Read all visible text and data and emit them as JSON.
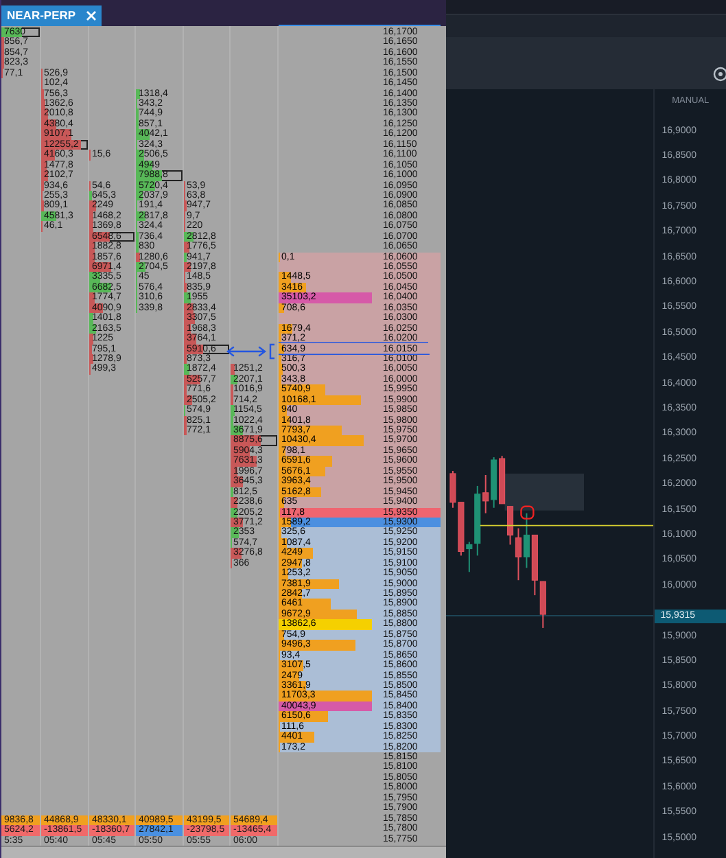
{
  "tab": {
    "label": "NEAR-PERP"
  },
  "footprint": {
    "columns": [
      {
        "cells": [
          {
            "value": "7630",
            "color": "#58b858",
            "boxed": true
          },
          {
            "value": "856,7",
            "color": "#c85858",
            "boxed": false
          },
          {
            "value": "854,7",
            "color": "#c85858",
            "boxed": false
          },
          {
            "value": "823,3",
            "color": "#c85858",
            "boxed": false
          },
          {
            "value": "77,1",
            "color": "#c85858",
            "boxed": false
          }
        ],
        "volume": "9836,8",
        "delta": {
          "value": "5624,2",
          "color": "#f06a6a"
        },
        "time": "5:35"
      },
      {
        "cells": [
          null,
          null,
          null,
          null,
          {
            "value": "526,9",
            "color": "#c85858",
            "boxed": false
          },
          {
            "value": "102,4",
            "color": "#c85858",
            "boxed": false
          },
          {
            "value": "756,3",
            "color": "#c85858",
            "boxed": false
          },
          {
            "value": "1362,6",
            "color": "#c85858",
            "boxed": false
          },
          {
            "value": "2010,8",
            "color": "#c85858",
            "boxed": false
          },
          {
            "value": "4380,4",
            "color": "#c85858",
            "boxed": false
          },
          {
            "value": "9107,1",
            "color": "#c85858",
            "boxed": false
          },
          {
            "value": "12255,2",
            "color": "#c85858",
            "boxed": true
          },
          {
            "value": "4160,3",
            "color": "#c85858",
            "boxed": false
          },
          {
            "value": "1477,8",
            "color": "#c85858",
            "boxed": false
          },
          {
            "value": "2102,7",
            "color": "#c85858",
            "boxed": false
          },
          {
            "value": "934,6",
            "color": "#c85858",
            "boxed": false
          },
          {
            "value": "255,3",
            "color": "#c85858",
            "boxed": false
          },
          {
            "value": "809,1",
            "color": "#c85858",
            "boxed": false
          },
          {
            "value": "4581,3",
            "color": "#58b858",
            "boxed": false
          },
          {
            "value": "46,1",
            "color": "#c85858",
            "boxed": false
          }
        ],
        "volume": "44868,9",
        "delta": {
          "value": "-13861,5",
          "color": "#f06a6a"
        },
        "time": "05:40"
      },
      {
        "cells": [
          null,
          null,
          null,
          null,
          null,
          null,
          null,
          null,
          null,
          null,
          null,
          null,
          {
            "value": "15,6",
            "color": "#c85858",
            "boxed": false
          },
          null,
          null,
          {
            "value": "54,6",
            "color": "#c85858",
            "boxed": false
          },
          {
            "value": "645,3",
            "color": "#58b858",
            "boxed": false
          },
          {
            "value": "2249",
            "color": "#c85858",
            "boxed": false
          },
          {
            "value": "1468,2",
            "color": "#c85858",
            "boxed": false
          },
          {
            "value": "1369,8",
            "color": "#c85858",
            "boxed": false
          },
          {
            "value": "6548,6",
            "color": "#c85858",
            "boxed": true
          },
          {
            "value": "1882,8",
            "color": "#c85858",
            "boxed": false
          },
          {
            "value": "1857,6",
            "color": "#c85858",
            "boxed": false
          },
          {
            "value": "6971,4",
            "color": "#c85858",
            "boxed": false
          },
          {
            "value": "3335,5",
            "color": "#58b858",
            "boxed": false
          },
          {
            "value": "6682,5",
            "color": "#58b858",
            "boxed": false
          },
          {
            "value": "1774,7",
            "color": "#c85858",
            "boxed": false
          },
          {
            "value": "4090,9",
            "color": "#c85858",
            "boxed": false
          },
          {
            "value": "1401,8",
            "color": "#58b858",
            "boxed": false
          },
          {
            "value": "2163,5",
            "color": "#58b858",
            "boxed": false
          },
          {
            "value": "1225",
            "color": "#c85858",
            "boxed": false
          },
          {
            "value": "795,1",
            "color": "#c85858",
            "boxed": false
          },
          {
            "value": "1278,9",
            "color": "#c85858",
            "boxed": false
          },
          {
            "value": "499,3",
            "color": "#c85858",
            "boxed": false
          }
        ],
        "volume": "48330,1",
        "delta": {
          "value": "-18360,7",
          "color": "#f06a6a"
        },
        "time": "05:45"
      },
      {
        "cells": [
          null,
          null,
          null,
          null,
          null,
          null,
          {
            "value": "1318,4",
            "color": "#58b858",
            "boxed": false
          },
          {
            "value": "343,2",
            "color": "#58b858",
            "boxed": false
          },
          {
            "value": "744,9",
            "color": "#58b858",
            "boxed": false
          },
          {
            "value": "857,1",
            "color": "#58b858",
            "boxed": false
          },
          {
            "value": "4042,1",
            "color": "#58b858",
            "boxed": false
          },
          {
            "value": "324,3",
            "color": "#58b858",
            "boxed": false
          },
          {
            "value": "2506,5",
            "color": "#58b858",
            "boxed": false
          },
          {
            "value": "4949",
            "color": "#58b858",
            "boxed": false
          },
          {
            "value": "7988,8",
            "color": "#58b858",
            "boxed": true
          },
          {
            "value": "5720,4",
            "color": "#58b858",
            "boxed": false
          },
          {
            "value": "2037,9",
            "color": "#58b858",
            "boxed": false
          },
          {
            "value": "191,4",
            "color": "#58b858",
            "boxed": false
          },
          {
            "value": "2817,8",
            "color": "#58b858",
            "boxed": false
          },
          {
            "value": "324,4",
            "color": "#58b858",
            "boxed": false
          },
          {
            "value": "736,4",
            "color": "#58b858",
            "boxed": false
          },
          {
            "value": "830",
            "color": "#58b858",
            "boxed": false
          },
          {
            "value": "1280,6",
            "color": "#c85858",
            "boxed": false
          },
          {
            "value": "2704,5",
            "color": "#58b858",
            "boxed": false
          },
          {
            "value": "45",
            "color": "#58b858",
            "boxed": false
          },
          {
            "value": "576,4",
            "color": "#58b858",
            "boxed": false
          },
          {
            "value": "310,6",
            "color": "#58b858",
            "boxed": false
          },
          {
            "value": "339,8",
            "color": "#58b858",
            "boxed": false
          }
        ],
        "volume": "40989,5",
        "delta": {
          "value": "27842,1",
          "color": "#4a90e0"
        },
        "time": "05:50"
      },
      {
        "cells": [
          null,
          null,
          null,
          null,
          null,
          null,
          null,
          null,
          null,
          null,
          null,
          null,
          null,
          null,
          null,
          {
            "value": "53,9",
            "color": "#c85858",
            "boxed": false
          },
          {
            "value": "63,8",
            "color": "#c85858",
            "boxed": false
          },
          {
            "value": "947,7",
            "color": "#c85858",
            "boxed": false
          },
          {
            "value": "9,7",
            "color": "#c85858",
            "boxed": false
          },
          {
            "value": "220",
            "color": "#c85858",
            "boxed": false
          },
          {
            "value": "2812,8",
            "color": "#58b858",
            "boxed": false
          },
          {
            "value": "1776,5",
            "color": "#c85858",
            "boxed": false
          },
          {
            "value": "941,7",
            "color": "#58b858",
            "boxed": false
          },
          {
            "value": "2197,8",
            "color": "#c85858",
            "boxed": false
          },
          {
            "value": "148,5",
            "color": "#c85858",
            "boxed": false
          },
          {
            "value": "835,9",
            "color": "#c85858",
            "boxed": false
          },
          {
            "value": "1955",
            "color": "#58b858",
            "boxed": false
          },
          {
            "value": "2833,4",
            "color": "#c85858",
            "boxed": false
          },
          {
            "value": "3307,5",
            "color": "#c85858",
            "boxed": false
          },
          {
            "value": "1968,3",
            "color": "#c85858",
            "boxed": false
          },
          {
            "value": "3764,1",
            "color": "#c85858",
            "boxed": false
          },
          {
            "value": "5910,6",
            "color": "#c85858",
            "boxed": true
          },
          {
            "value": "873,3",
            "color": "#c85858",
            "boxed": false
          },
          {
            "value": "1872,4",
            "color": "#58b858",
            "boxed": false
          },
          {
            "value": "5257,7",
            "color": "#c85858",
            "boxed": false
          },
          {
            "value": "771,6",
            "color": "#c85858",
            "boxed": false
          },
          {
            "value": "2505,2",
            "color": "#c85858",
            "boxed": false
          },
          {
            "value": "574,9",
            "color": "#58b858",
            "boxed": false
          },
          {
            "value": "825,1",
            "color": "#c85858",
            "boxed": false
          },
          {
            "value": "772,1",
            "color": "#c85858",
            "boxed": false
          }
        ],
        "volume": "43199,5",
        "delta": {
          "value": "-23798,5",
          "color": "#f06a6a"
        },
        "time": "05:55"
      },
      {
        "cells": [
          null,
          null,
          null,
          null,
          null,
          null,
          null,
          null,
          null,
          null,
          null,
          null,
          null,
          null,
          null,
          null,
          null,
          null,
          null,
          null,
          null,
          null,
          null,
          null,
          null,
          null,
          null,
          null,
          null,
          null,
          null,
          null,
          null,
          {
            "value": "1251,2",
            "color": "#c85858",
            "boxed": false
          },
          {
            "value": "2207,1",
            "color": "#58b858",
            "boxed": false
          },
          {
            "value": "1016,9",
            "color": "#c85858",
            "boxed": false
          },
          {
            "value": "714,2",
            "color": "#c85858",
            "boxed": false
          },
          {
            "value": "1154,5",
            "color": "#58b858",
            "boxed": false
          },
          {
            "value": "1022,4",
            "color": "#58b858",
            "boxed": false
          },
          {
            "value": "3671,9",
            "color": "#58b858",
            "boxed": false
          },
          {
            "value": "8875,6",
            "color": "#c85858",
            "boxed": true
          },
          {
            "value": "5904,3",
            "color": "#c85858",
            "boxed": false
          },
          {
            "value": "7631,3",
            "color": "#c85858",
            "boxed": false
          },
          {
            "value": "1996,7",
            "color": "#c85858",
            "boxed": false
          },
          {
            "value": "3645,3",
            "color": "#c85858",
            "boxed": false
          },
          {
            "value": "812,5",
            "color": "#58b858",
            "boxed": false
          },
          {
            "value": "2238,6",
            "color": "#c85858",
            "boxed": false
          },
          {
            "value": "2205,2",
            "color": "#58b858",
            "boxed": false
          },
          {
            "value": "3771,2",
            "color": "#c85858",
            "boxed": false
          },
          {
            "value": "2353",
            "color": "#58b858",
            "boxed": false
          },
          {
            "value": "574,7",
            "color": "#58b858",
            "boxed": false
          },
          {
            "value": "3276,8",
            "color": "#c85858",
            "boxed": false
          },
          {
            "value": "366",
            "color": "#c85858",
            "boxed": false
          }
        ],
        "volume": "54689,4",
        "delta": {
          "value": "-13465,4",
          "color": "#f06a6a"
        },
        "time": "06:00"
      }
    ]
  },
  "ladder": {
    "rows": [
      {
        "price": "16,1700",
        "kind": "empty"
      },
      {
        "price": "16,1650",
        "kind": "empty"
      },
      {
        "price": "16,1600",
        "kind": "empty"
      },
      {
        "price": "16,1550",
        "kind": "empty"
      },
      {
        "price": "16,1500",
        "kind": "empty"
      },
      {
        "price": "16,1450",
        "kind": "empty"
      },
      {
        "price": "16,1400",
        "kind": "empty"
      },
      {
        "price": "16,1350",
        "kind": "empty"
      },
      {
        "price": "16,1300",
        "kind": "empty"
      },
      {
        "price": "16,1250",
        "kind": "empty"
      },
      {
        "price": "16,1200",
        "kind": "empty"
      },
      {
        "price": "16,1150",
        "kind": "empty"
      },
      {
        "price": "16,1100",
        "kind": "empty"
      },
      {
        "price": "16,1050",
        "kind": "empty"
      },
      {
        "price": "16,1000",
        "kind": "empty"
      },
      {
        "price": "16,0950",
        "kind": "empty"
      },
      {
        "price": "16,0900",
        "kind": "empty"
      },
      {
        "price": "16,0850",
        "kind": "empty"
      },
      {
        "price": "16,0800",
        "kind": "empty"
      },
      {
        "price": "16,0750",
        "kind": "empty"
      },
      {
        "price": "16,0700",
        "kind": "empty"
      },
      {
        "price": "16,0650",
        "kind": "empty"
      },
      {
        "price": "16,0600",
        "kind": "ask",
        "volume": {
          "value": "0,1",
          "color": "#f0a020"
        }
      },
      {
        "price": "16,0550",
        "kind": "ask"
      },
      {
        "price": "16,0500",
        "kind": "ask",
        "volume": {
          "value": "1448,5",
          "color": "#f0a020"
        }
      },
      {
        "price": "16,0450",
        "kind": "ask",
        "volume": {
          "value": "3416",
          "color": "#f0a020"
        }
      },
      {
        "price": "16,0400",
        "kind": "ask",
        "volume": {
          "value": "35103,2",
          "color": "#d65aa8"
        }
      },
      {
        "price": "16,0350",
        "kind": "ask",
        "volume": {
          "value": "708,6",
          "color": "#f0a020"
        }
      },
      {
        "price": "16,0300",
        "kind": "ask"
      },
      {
        "price": "16,0250",
        "kind": "ask",
        "volume": {
          "value": "1679,4",
          "color": "#f0a020"
        }
      },
      {
        "price": "16,0200",
        "kind": "ask",
        "volume": {
          "value": "371,2",
          "color": "#f0a020"
        }
      },
      {
        "price": "16,0150",
        "kind": "ask",
        "volume": {
          "value": "634,9",
          "color": "#f0a020"
        }
      },
      {
        "price": "16,0100",
        "kind": "ask",
        "volume": {
          "value": "316,7",
          "color": "#f0a020"
        }
      },
      {
        "price": "16,0050",
        "kind": "ask",
        "volume": {
          "value": "500,3",
          "color": "#f0a020"
        }
      },
      {
        "price": "16,0000",
        "kind": "ask",
        "volume": {
          "value": "343,8",
          "color": "#f0a020"
        }
      },
      {
        "price": "15,9950",
        "kind": "ask",
        "volume": {
          "value": "5740,9",
          "color": "#f0a020"
        }
      },
      {
        "price": "15,9900",
        "kind": "ask",
        "volume": {
          "value": "10168,1",
          "color": "#f0a020"
        }
      },
      {
        "price": "15,9850",
        "kind": "ask",
        "volume": {
          "value": "940",
          "color": "#f0a020"
        }
      },
      {
        "price": "15,9800",
        "kind": "ask",
        "volume": {
          "value": "1401,8",
          "color": "#f0a020"
        }
      },
      {
        "price": "15,9750",
        "kind": "ask",
        "volume": {
          "value": "7793,7",
          "color": "#f0a020"
        }
      },
      {
        "price": "15,9700",
        "kind": "ask",
        "volume": {
          "value": "10430,4",
          "color": "#f0a020"
        }
      },
      {
        "price": "15,9650",
        "kind": "ask",
        "volume": {
          "value": "798,1",
          "color": "#f0a020"
        }
      },
      {
        "price": "15,9600",
        "kind": "ask",
        "volume": {
          "value": "6591,6",
          "color": "#f0a020"
        }
      },
      {
        "price": "15,9550",
        "kind": "ask",
        "volume": {
          "value": "5676,1",
          "color": "#f0a020"
        }
      },
      {
        "price": "15,9500",
        "kind": "ask",
        "volume": {
          "value": "3963,4",
          "color": "#f0a020"
        }
      },
      {
        "price": "15,9450",
        "kind": "ask",
        "volume": {
          "value": "5162,8",
          "color": "#f0a020"
        }
      },
      {
        "price": "15,9400",
        "kind": "ask",
        "volume": {
          "value": "635",
          "color": "#f0a020"
        }
      },
      {
        "price": "15,9350",
        "kind": "best_ask",
        "volume": {
          "value": "117,8",
          "color": "#f0a020"
        }
      },
      {
        "price": "15,9300",
        "kind": "best_bid",
        "volume": {
          "value": "1589,2",
          "color": "#f0a020"
        }
      },
      {
        "price": "15,9250",
        "kind": "bid",
        "volume": {
          "value": "325,6",
          "color": "#f0a020"
        }
      },
      {
        "price": "15,9200",
        "kind": "bid",
        "volume": {
          "value": "1087,4",
          "color": "#f0a020"
        }
      },
      {
        "price": "15,9150",
        "kind": "bid",
        "volume": {
          "value": "4249",
          "color": "#f0a020"
        }
      },
      {
        "price": "15,9100",
        "kind": "bid",
        "volume": {
          "value": "2947,8",
          "color": "#f0a020"
        }
      },
      {
        "price": "15,9050",
        "kind": "bid",
        "volume": {
          "value": "1253,2",
          "color": "#f0a020"
        }
      },
      {
        "price": "15,9000",
        "kind": "bid",
        "volume": {
          "value": "7381,9",
          "color": "#f0a020"
        }
      },
      {
        "price": "15,8950",
        "kind": "bid",
        "volume": {
          "value": "2842,7",
          "color": "#f0a020"
        }
      },
      {
        "price": "15,8900",
        "kind": "bid",
        "volume": {
          "value": "6461",
          "color": "#f0a020"
        }
      },
      {
        "price": "15,8850",
        "kind": "bid",
        "volume": {
          "value": "9672,9",
          "color": "#f0a020"
        }
      },
      {
        "price": "15,8800",
        "kind": "bid",
        "volume": {
          "value": "13862,6",
          "color": "#f5d000"
        }
      },
      {
        "price": "15,8750",
        "kind": "bid",
        "volume": {
          "value": "754,9",
          "color": "#f0a020"
        }
      },
      {
        "price": "15,8700",
        "kind": "bid",
        "volume": {
          "value": "9496,3",
          "color": "#f0a020"
        }
      },
      {
        "price": "15,8650",
        "kind": "bid",
        "volume": {
          "value": "93,4",
          "color": "#f0a020"
        }
      },
      {
        "price": "15,8600",
        "kind": "bid",
        "volume": {
          "value": "3107,5",
          "color": "#f0a020"
        }
      },
      {
        "price": "15,8550",
        "kind": "bid",
        "volume": {
          "value": "2479",
          "color": "#f0a020"
        }
      },
      {
        "price": "15,8500",
        "kind": "bid",
        "volume": {
          "value": "3361,9",
          "color": "#f0a020"
        }
      },
      {
        "price": "15,8450",
        "kind": "bid",
        "volume": {
          "value": "11703,3",
          "color": "#f0a020"
        }
      },
      {
        "price": "15,8400",
        "kind": "bid",
        "volume": {
          "value": "40043,9",
          "color": "#d65aa8"
        }
      },
      {
        "price": "15,8350",
        "kind": "bid",
        "volume": {
          "value": "6150,6",
          "color": "#f0a020"
        }
      },
      {
        "price": "15,8300",
        "kind": "bid",
        "volume": {
          "value": "111,6",
          "color": "#f0a020"
        }
      },
      {
        "price": "15,8250",
        "kind": "bid",
        "volume": {
          "value": "4401",
          "color": "#f0a020"
        }
      },
      {
        "price": "15,8200",
        "kind": "bid",
        "volume": {
          "value": "173,2",
          "color": "#f0a020"
        }
      },
      {
        "price": "15,8150",
        "kind": "empty"
      },
      {
        "price": "15,8100",
        "kind": "empty"
      },
      {
        "price": "15,8050",
        "kind": "empty"
      },
      {
        "price": "15,8000",
        "kind": "empty"
      },
      {
        "price": "15,7950",
        "kind": "empty"
      },
      {
        "price": "15,7900",
        "kind": "empty"
      },
      {
        "price": "15,7850",
        "kind": "empty"
      },
      {
        "price": "15,7800",
        "kind": "empty"
      },
      {
        "price": "15,7750",
        "kind": "empty"
      }
    ]
  },
  "chart": {
    "mode_label": "MANUAL",
    "axis": [
      {
        "kind": "label",
        "text": "16,9000"
      },
      {
        "kind": "label",
        "text": "16,8500"
      },
      {
        "kind": "label",
        "text": "16,8000"
      },
      {
        "kind": "label",
        "text": "16,7500"
      },
      {
        "kind": "label",
        "text": "16,7000"
      },
      {
        "kind": "label",
        "text": "16,6500"
      },
      {
        "kind": "label",
        "text": "16,6000"
      },
      {
        "kind": "label",
        "text": "16,5500"
      },
      {
        "kind": "label",
        "text": "16,5000"
      },
      {
        "kind": "label",
        "text": "16,4500"
      },
      {
        "kind": "label",
        "text": "16,4000"
      },
      {
        "kind": "label",
        "text": "16,3500"
      },
      {
        "kind": "label",
        "text": "16,3000"
      },
      {
        "kind": "label",
        "text": "16,2500"
      },
      {
        "kind": "label",
        "text": "16,2000"
      },
      {
        "kind": "label",
        "text": "16,1500"
      },
      {
        "kind": "label",
        "text": "16,1000"
      },
      {
        "kind": "label",
        "text": "16,0500"
      },
      {
        "kind": "label",
        "text": "16,0000"
      },
      {
        "kind": "price_tag",
        "text": "15,9315"
      },
      {
        "kind": "label",
        "text": "15,9000"
      },
      {
        "kind": "label",
        "text": "15,8500"
      },
      {
        "kind": "label",
        "text": "15,8000"
      },
      {
        "kind": "label",
        "text": "15,7500"
      },
      {
        "kind": "label",
        "text": "15,7000"
      },
      {
        "kind": "label",
        "text": "15,6500"
      },
      {
        "kind": "label",
        "text": "15,6000"
      },
      {
        "kind": "label",
        "text": "15,5500"
      },
      {
        "kind": "label",
        "text": "15,5000"
      }
    ]
  }
}
